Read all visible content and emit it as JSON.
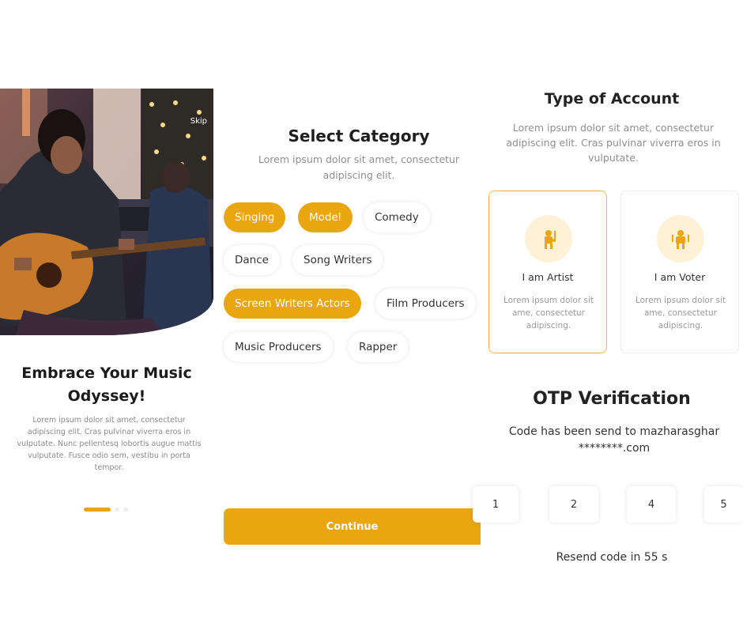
{
  "onboarding": {
    "skip_label": "Skip",
    "title": "Embrace Your Music Odyssey!",
    "description": "Lorem ipsum dolor sit amet, consectetur adipiscing elit. Cras pulvinar viverra eros in vulputate. Nunc pellentesq lobortis augue mattis vulputate. Fusce odio sem, vestibu in porta tempor.",
    "page_indicator": {
      "active_index": 0,
      "count": 3
    },
    "accent_color": "#e9a60f"
  },
  "category": {
    "title": "Select Category",
    "description": "Lorem ipsum dolor sit amet, consectetur adipiscing elit.",
    "chips": [
      {
        "label": "Singing",
        "selected": true
      },
      {
        "label": "Model",
        "selected": true
      },
      {
        "label": "Comedy",
        "selected": false
      },
      {
        "label": "Dance",
        "selected": false
      },
      {
        "label": "Song Writers",
        "selected": false
      },
      {
        "label": "Screen Writers Actors",
        "selected": true
      },
      {
        "label": "Film Producers",
        "selected": false
      },
      {
        "label": "Music Producers",
        "selected": false
      },
      {
        "label": "Rapper",
        "selected": false
      }
    ],
    "continue_label": "Continue"
  },
  "account": {
    "title": "Type of Account",
    "description": "Lorem ipsum dolor sit amet, consectetur adipiscing elit. Cras pulvinar viverra eros in vulputate.",
    "options": [
      {
        "label": "I am Artist",
        "description": "Lorem ipsum dolor sit ame, consectetur adipiscing.",
        "icon": "artist-icon",
        "selected": true
      },
      {
        "label": "I am Voter",
        "description": "Lorem ipsum dolor sit ame, consectetur adipiscing.",
        "icon": "voter-icon",
        "selected": false
      }
    ]
  },
  "otp": {
    "title": "OTP Verification",
    "subtitle_line1": "Code has been send to mazharasghar",
    "subtitle_line2": "********.com",
    "digits": [
      "1",
      "2",
      "4",
      "5"
    ],
    "resend_text": "Resend code in 55 s"
  }
}
